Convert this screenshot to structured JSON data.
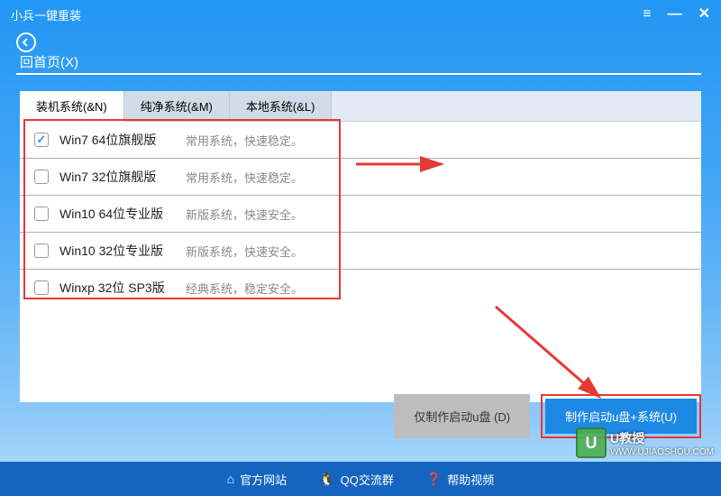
{
  "titlebar": {
    "app_name": "小兵一键重装"
  },
  "nav": {
    "back_label": "回首页(X)"
  },
  "tabs": [
    {
      "label": "装机系统(&N)",
      "active": true
    },
    {
      "label": "纯净系统(&M)",
      "active": false
    },
    {
      "label": "本地系统(&L)",
      "active": false
    }
  ],
  "systems": [
    {
      "name": "Win7 64位旗舰版",
      "desc": "常用系统，快速稳定。",
      "checked": true
    },
    {
      "name": "Win7 32位旗舰版",
      "desc": "常用系统，快速稳定。",
      "checked": false
    },
    {
      "name": "Win10 64位专业版",
      "desc": "新版系统，快速安全。",
      "checked": false
    },
    {
      "name": "Win10 32位专业版",
      "desc": "新版系统，快速安全。",
      "checked": false
    },
    {
      "name": "Winxp 32位 SP3版",
      "desc": "经典系统，稳定安全。",
      "checked": false
    }
  ],
  "buttons": {
    "make_boot_only": "仅制作启动u盘 (D)",
    "make_boot_system": "制作启动u盘+系统(U)"
  },
  "footer": {
    "website": "官方网站",
    "qqgroup": "QQ交流群",
    "help": "帮助视频"
  },
  "watermark": {
    "brand": "U教授",
    "url": "WWW.UJIAOSHOU.COM",
    "badge": "U"
  }
}
